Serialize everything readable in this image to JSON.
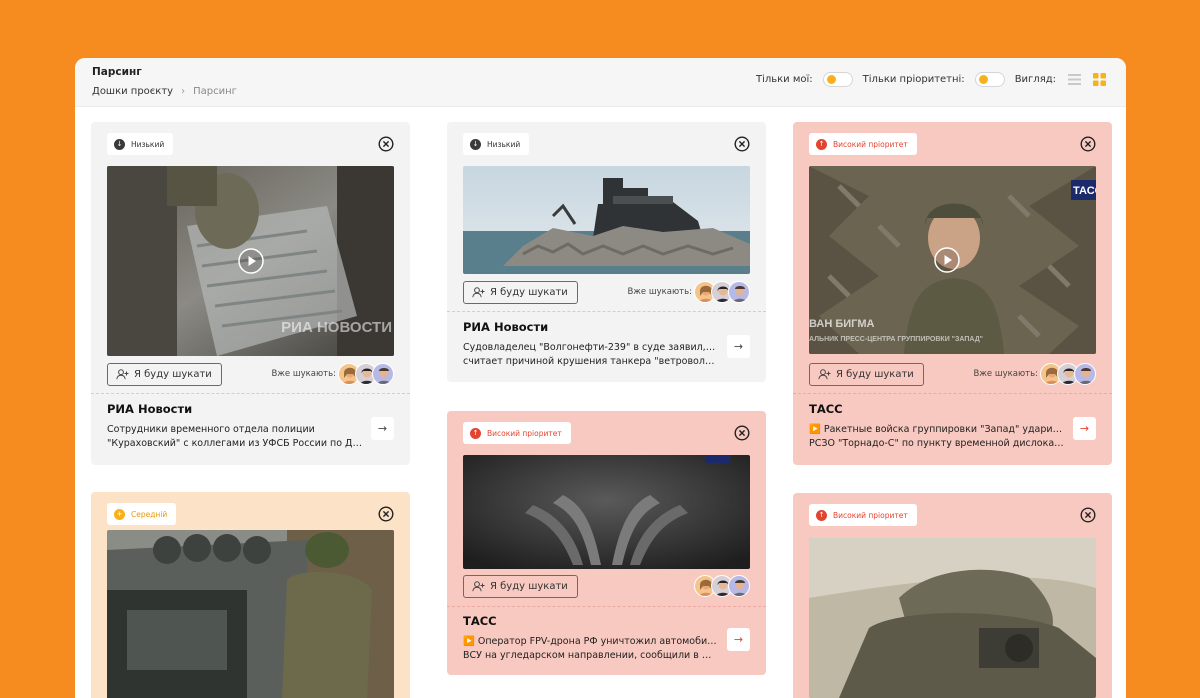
{
  "header": {
    "title": "Парсинг",
    "breadcrumb": {
      "parent": "Дошки проєкту",
      "separator": "›",
      "current": "Парсинг"
    },
    "filters": {
      "only_mine": "Тільки мої:",
      "only_priority": "Тільки пріоритетні:",
      "view": "Вигляд:"
    }
  },
  "common": {
    "search_button": "Я буду шукати",
    "already_searching": "Вже шукають:",
    "arrow": "→"
  },
  "cards": [
    {
      "priority": "Низький",
      "source": "РИА Новости",
      "desc_line1": "Сотрудники временного отдела полиции",
      "desc_line2": "\"Кураховский\" с коллегами из УФСБ России по ДНР...",
      "watermark": "РИА НОВОСТИ"
    },
    {
      "priority": "Низький",
      "source": "РИА Новости",
      "desc_line1": "Судовладелец \"Волгонефти-239\" в суде заявил, что",
      "desc_line2": "считает причиной крушения танкера \"ветроволнов..."
    },
    {
      "priority": "Високий пріоритет",
      "source": "ТАСС",
      "desc_line1": "▶️ Ракетные войска группировки \"Запад\" ударили из",
      "desc_line2": "РСЗО \"Торнадо-С\" по пункту временной дислокаци...",
      "watermark": "ТАСС",
      "caption_name": "ВАН БИГМА",
      "caption_role": "АЛЬНИК ПРЕСС-ЦЕНТРА ГРУППИРОВКИ \"ЗАПАД\""
    },
    {
      "priority": "Високий пріоритет",
      "source": "ТАСС",
      "desc_line1": "▶️ Оператор FPV-дрона РФ уничтожил автомобиль",
      "desc_line2": "ВСУ на угледарском направлении, сообщили в МО..."
    },
    {
      "priority": "Середній"
    },
    {
      "priority": "Високий пріоритет"
    }
  ],
  "colors": {
    "background": "#F68B1F",
    "low_card": "#F3F3F4",
    "high_card": "#F8C9C0",
    "mid_card": "#FCE3C7",
    "high_accent": "#E2452F",
    "mid_accent": "#F7B21B",
    "toggle_knob": "#F7B21B"
  },
  "icons": [
    "close-circle-icon",
    "play-icon",
    "add-user-icon",
    "arrow-right-icon",
    "list-view-icon",
    "grid-view-icon",
    "arrow-down-icon",
    "arrow-up-icon",
    "plus-icon"
  ]
}
